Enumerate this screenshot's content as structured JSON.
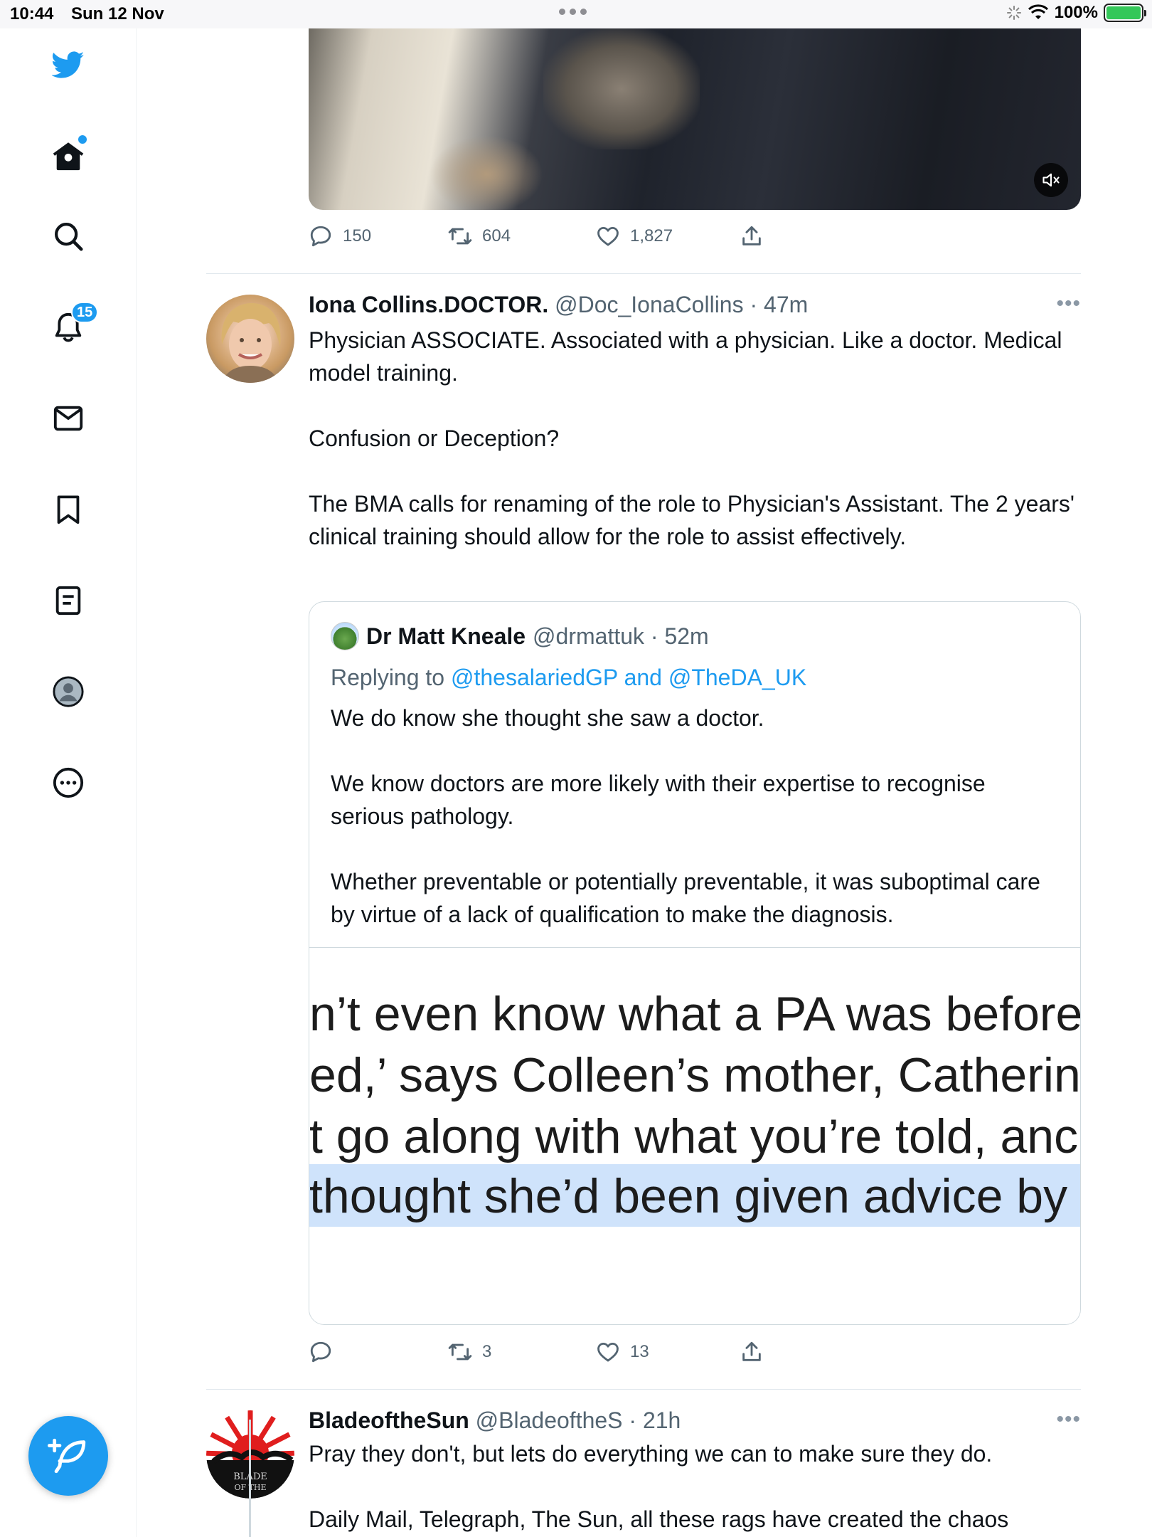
{
  "status_bar": {
    "time": "10:44",
    "date": "Sun 12 Nov",
    "battery": "100%"
  },
  "sidebar": {
    "notification_count": "15",
    "items": [
      {
        "icon": "twitter-bird-icon"
      },
      {
        "icon": "home-icon"
      },
      {
        "icon": "search-icon"
      },
      {
        "icon": "bell-icon"
      },
      {
        "icon": "mail-icon"
      },
      {
        "icon": "bookmark-icon"
      },
      {
        "icon": "lists-icon"
      },
      {
        "icon": "profile-icon"
      },
      {
        "icon": "more-icon"
      }
    ]
  },
  "prev_tweet": {
    "replies": "150",
    "retweets": "604",
    "likes": "1,827"
  },
  "tweet1": {
    "name": "Iona Collins.DOCTOR.",
    "handle": "@Doc_IonaCollins",
    "time": "47m",
    "paragraphs": [
      "Physician ASSOCIATE. Associated with a physician. Like a doctor. Medical model training.",
      "Confusion or Deception?",
      "The BMA calls for renaming of the role to Physician's Assistant. The 2 years' clinical training should allow for the role to  assist effectively."
    ],
    "quote": {
      "name": "Dr Matt Kneale",
      "handle": "@drmattuk",
      "time": "52m",
      "replying_prefix": "Replying to",
      "replying_to": "@thesalariedGP and @TheDA_UK",
      "paragraphs": [
        "We do know she thought she saw a doctor.",
        "We know doctors are more likely with their expertise to recognise serious pathology.",
        "Whether preventable or potentially preventable, it was suboptimal care by virtue of a lack of qualification to make the diagnosis."
      ],
      "image_text": [
        "n’t even know what a PA was before",
        "ed,’ says Colleen’s mother, Catherin",
        "t go along with what you’re told, anc",
        "thought she’d been given advice by"
      ]
    },
    "retweets": "3",
    "likes": "13"
  },
  "tweet2": {
    "name": "BladeoftheSun",
    "handle": "@BladeoftheS",
    "time": "21h",
    "avatar_text": "BLADE OF THE",
    "paragraphs": [
      "Pray they don't, but lets do everything we can to make sure they do.",
      "Daily Mail, Telegraph, The Sun, all these rags have created the chaos"
    ]
  },
  "colors": {
    "accent": "#1d9bf0",
    "text": "#0f1419",
    "muted": "#536471",
    "border": "#cfd9de"
  }
}
